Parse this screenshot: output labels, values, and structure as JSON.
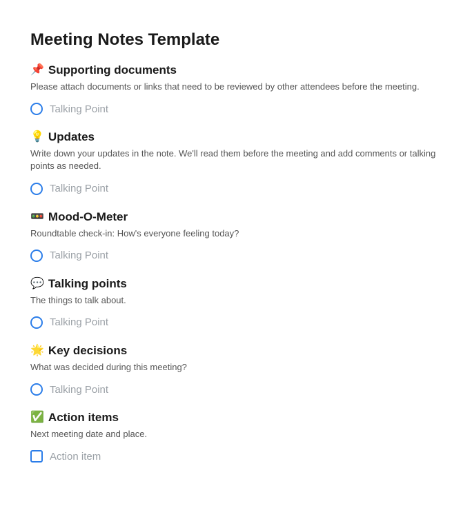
{
  "title": "Meeting Notes Template",
  "sections": [
    {
      "emoji": "📌",
      "heading": "Supporting documents",
      "description": "Please attach documents or links that need to be reviewed by other attendees before the meeting.",
      "placeholder": "Talking Point",
      "itemType": "radio"
    },
    {
      "emoji": "💡",
      "heading": "Updates",
      "description": "Write down your updates in the note. We'll read them before the meeting and add comments or talking points as needed.",
      "placeholder": "Talking Point",
      "itemType": "radio"
    },
    {
      "emoji": "🚥",
      "heading": "Mood-O-Meter",
      "description": "Roundtable check-in: How's everyone feeling today?",
      "placeholder": "Talking Point",
      "itemType": "radio"
    },
    {
      "emoji": "💬",
      "heading": "Talking points",
      "description": "The things to talk about.",
      "placeholder": "Talking Point",
      "itemType": "radio"
    },
    {
      "emoji": "🌟",
      "heading": "Key decisions",
      "description": "What was decided during this meeting?",
      "placeholder": "Talking Point",
      "itemType": "radio"
    },
    {
      "emoji": "✅",
      "heading": "Action items",
      "description": "Next meeting date and place.",
      "placeholder": "Action item",
      "itemType": "checkbox"
    }
  ]
}
